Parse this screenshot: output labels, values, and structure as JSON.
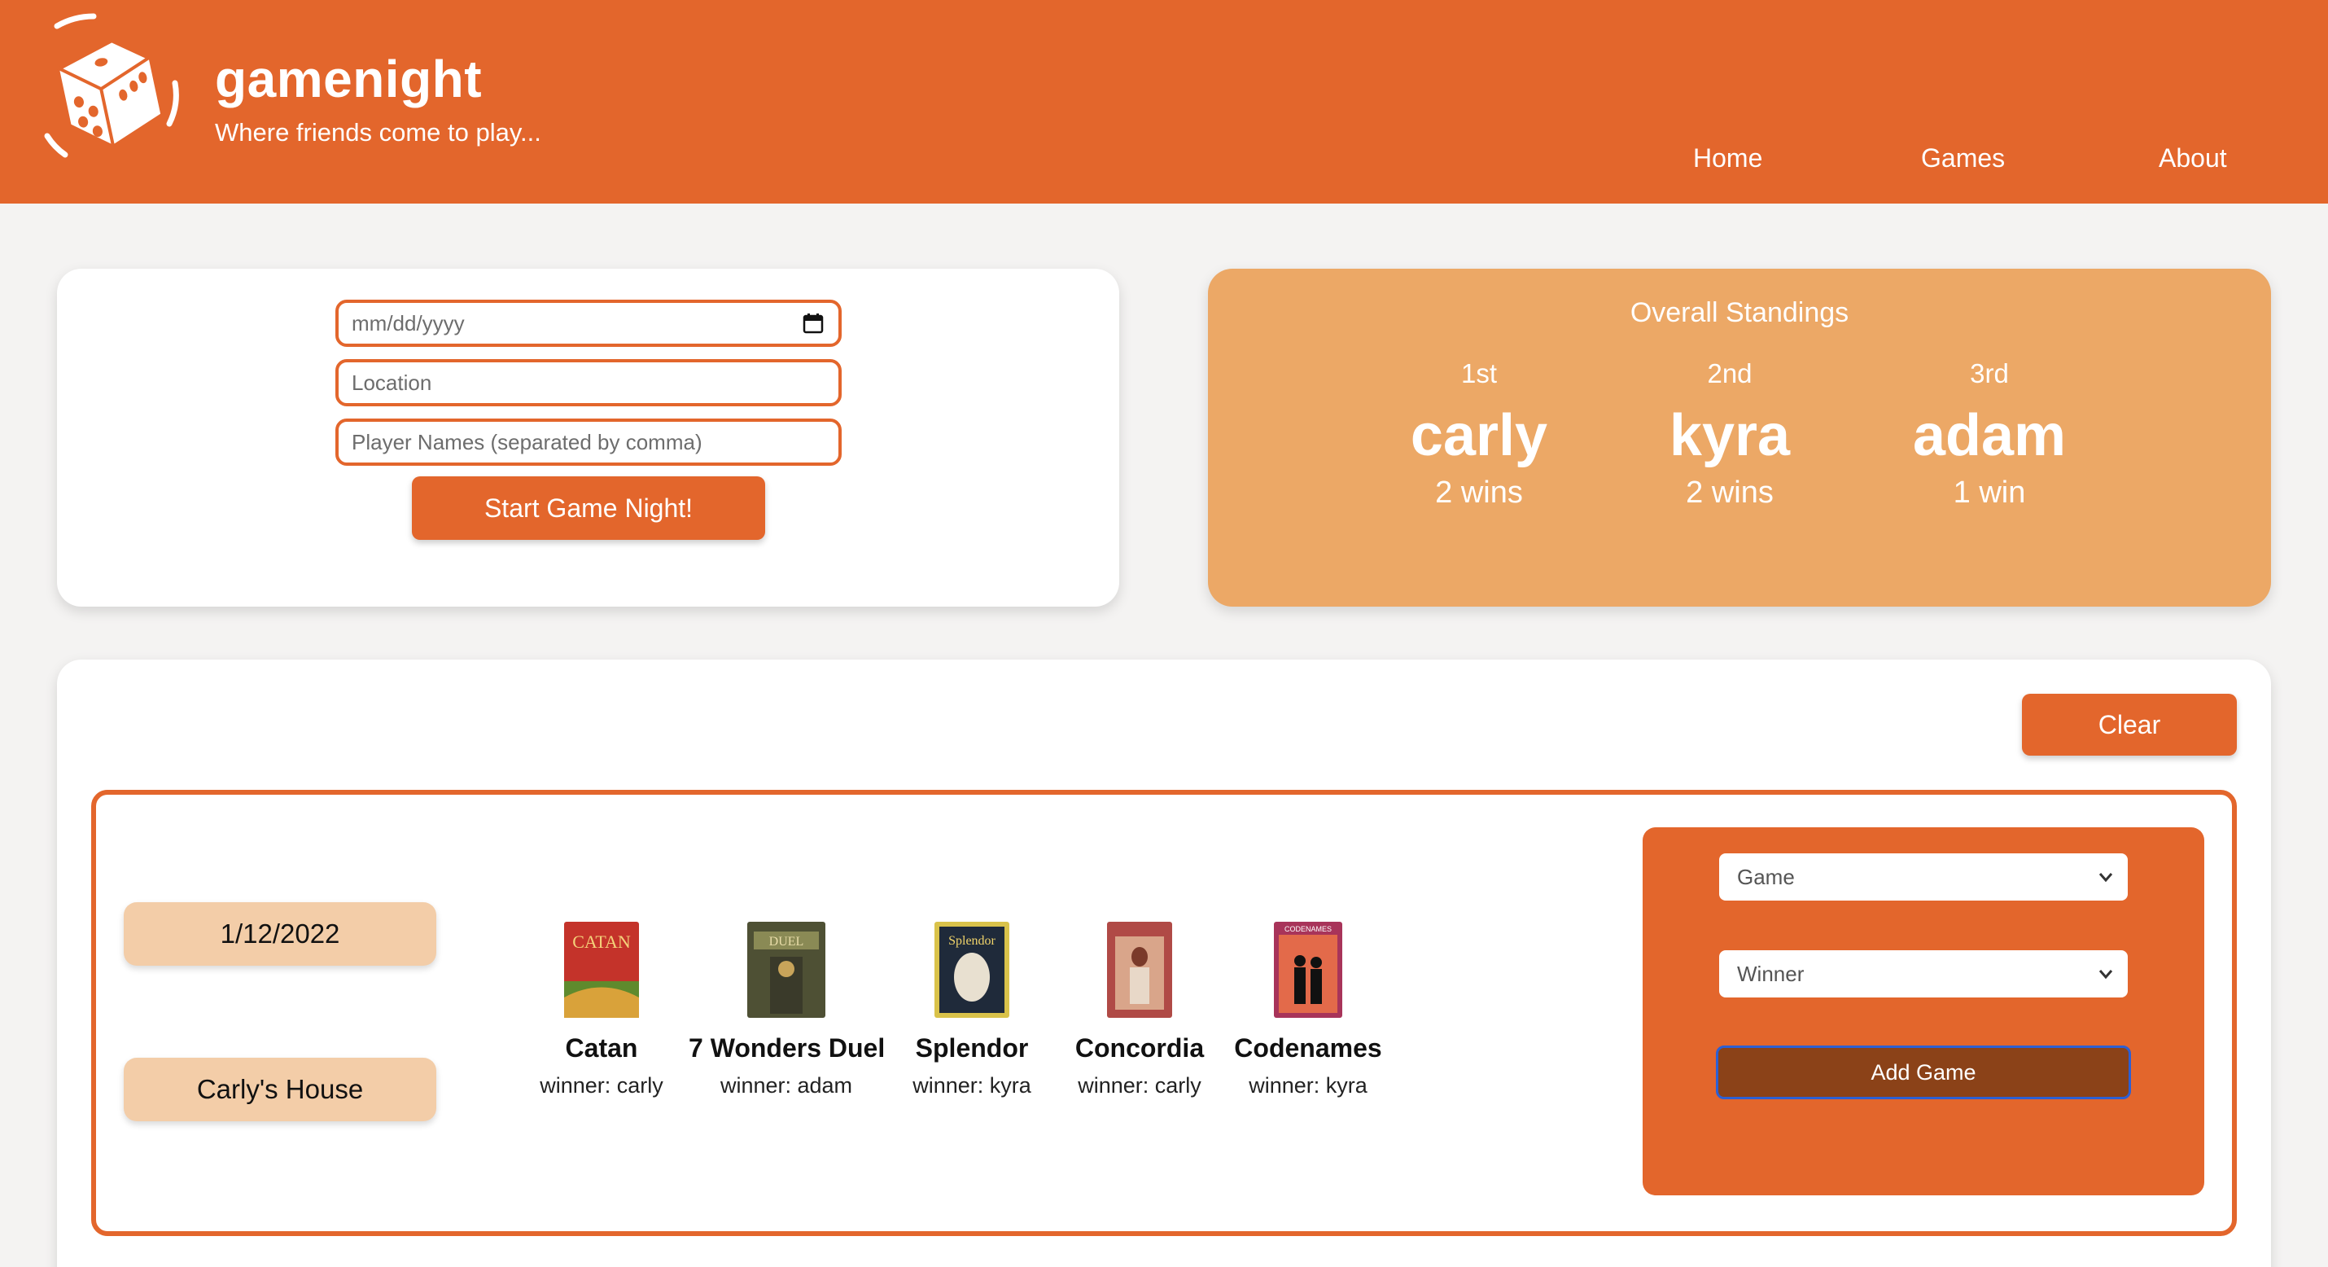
{
  "header": {
    "title": "gamenight",
    "tagline": "Where friends come to play...",
    "nav": [
      "Home",
      "Games",
      "About"
    ]
  },
  "form": {
    "date_placeholder": "mm/dd/yyyy",
    "location_placeholder": "Location",
    "players_placeholder": "Player Names (separated by comma)",
    "start_label": "Start Game Night!"
  },
  "standings": {
    "title": "Overall Standings",
    "ranks": [
      {
        "place": "1st",
        "name": "carly",
        "wins": "2 wins"
      },
      {
        "place": "2nd",
        "name": "kyra",
        "wins": "2 wins"
      },
      {
        "place": "3rd",
        "name": "adam",
        "wins": "1 win"
      }
    ]
  },
  "nights": {
    "clear_label": "Clear",
    "entry": {
      "date": "1/12/2022",
      "location": "Carly's House",
      "games": [
        {
          "name": "Catan",
          "winner": "winner: carly",
          "box_label": "CATAN",
          "box_color": "#c4332a"
        },
        {
          "name": "7 Wonders Duel",
          "winner": "winner: adam",
          "box_label": "DUEL",
          "box_color": "#5a5a3a"
        },
        {
          "name": "Splendor",
          "winner": "winner: kyra",
          "box_label": "Splendor",
          "box_color": "#1f2a3a"
        },
        {
          "name": "Concordia",
          "winner": "winner: carly",
          "box_label": "",
          "box_color": "#b04a46"
        },
        {
          "name": "Codenames",
          "winner": "winner: kyra",
          "box_label": "CODENAMES",
          "box_color": "#a8345a"
        }
      ]
    },
    "add_form": {
      "game_select": "Game",
      "winner_select": "Winner",
      "add_label": "Add Game"
    }
  },
  "colors": {
    "accent": "#e3662c",
    "standings_bg": "#eca866",
    "pill_bg": "#f3cda8",
    "add_button": "#8b4218"
  }
}
